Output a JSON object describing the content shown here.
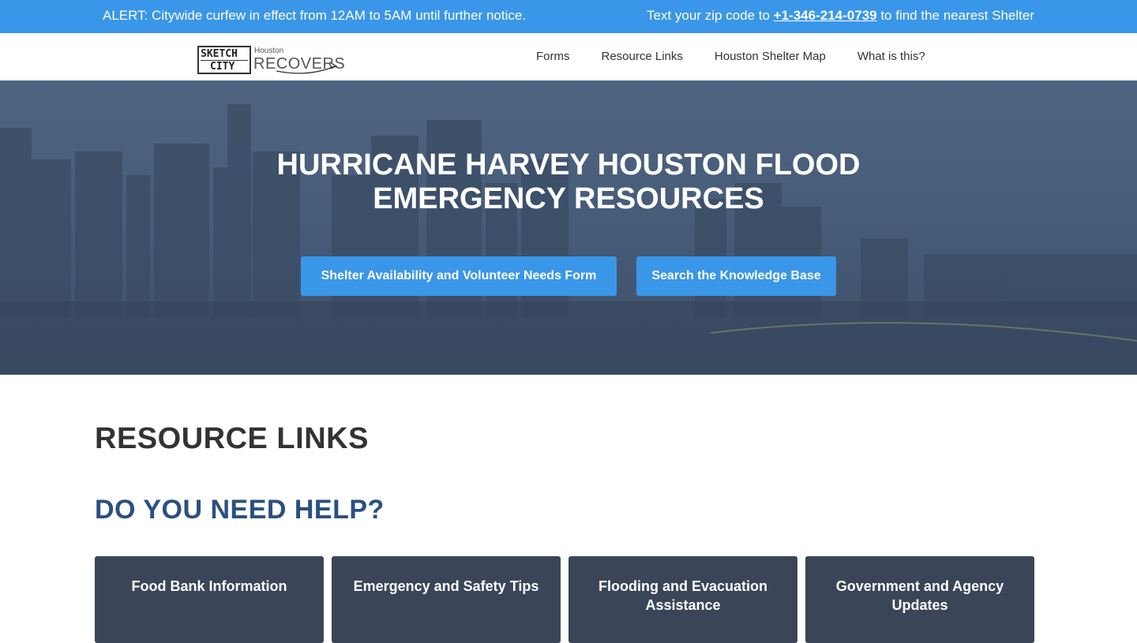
{
  "alert": {
    "left_text": "ALERT: Citywide curfew in effect from 12AM to 5AM until further notice.",
    "right_prefix": "Text your zip code to ",
    "phone": "+1-346-214-0739",
    "right_suffix": " to find the nearest Shelter"
  },
  "logo": {
    "sketch_line1": "SKETCH",
    "sketch_line2": "CITY",
    "small": "Houston",
    "big": "RECOVERS"
  },
  "nav": {
    "items": [
      {
        "label": "Forms"
      },
      {
        "label": "Resource Links"
      },
      {
        "label": "Houston Shelter Map"
      },
      {
        "label": "What is this?"
      }
    ]
  },
  "hero": {
    "title_line1": "HURRICANE HARVEY HOUSTON FLOOD",
    "title_line2": "EMERGENCY RESOURCES",
    "button_form": "Shelter Availability and Volunteer Needs Form",
    "button_kb": "Search the Knowledge Base"
  },
  "resources": {
    "title": "RESOURCE LINKS",
    "help_title": "DO YOU NEED HELP?",
    "cards": [
      {
        "label": "Food Bank Information"
      },
      {
        "label": "Emergency and Safety Tips"
      },
      {
        "label": "Flooding and Evacuation Assistance"
      },
      {
        "label": "Government and Agency Updates"
      }
    ]
  },
  "colors": {
    "accent": "#3a96e8",
    "card_bg": "#3a4558",
    "help_heading": "#2a5080"
  }
}
